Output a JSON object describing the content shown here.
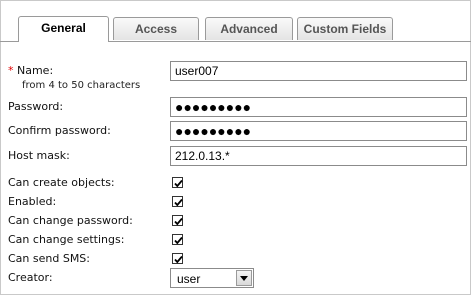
{
  "tabs": [
    {
      "label": "General",
      "active": true
    },
    {
      "label": "Access",
      "active": false
    },
    {
      "label": "Advanced",
      "active": false
    },
    {
      "label": "Custom Fields",
      "active": false
    }
  ],
  "form": {
    "name": {
      "required_mark": "*",
      "label": "Name:",
      "hint": "from 4 to 50 characters",
      "value": "user007"
    },
    "password": {
      "label": "Password:",
      "value": "●●●●●●●●●"
    },
    "confirm_password": {
      "label": "Confirm password:",
      "value": "●●●●●●●●●"
    },
    "host_mask": {
      "label": "Host mask:",
      "value": "212.0.13.*"
    },
    "can_create_objects": {
      "label": "Can create objects:",
      "checked": true
    },
    "enabled": {
      "label": "Enabled:",
      "checked": true
    },
    "can_change_password": {
      "label": "Can change password:",
      "checked": true
    },
    "can_change_settings": {
      "label": "Can change settings:",
      "checked": true
    },
    "can_send_sms": {
      "label": "Can send SMS:",
      "checked": true
    },
    "creator": {
      "label": "Creator:",
      "value": "user"
    }
  },
  "colors": {
    "required": "#e00000",
    "border": "#8b8b8b"
  }
}
